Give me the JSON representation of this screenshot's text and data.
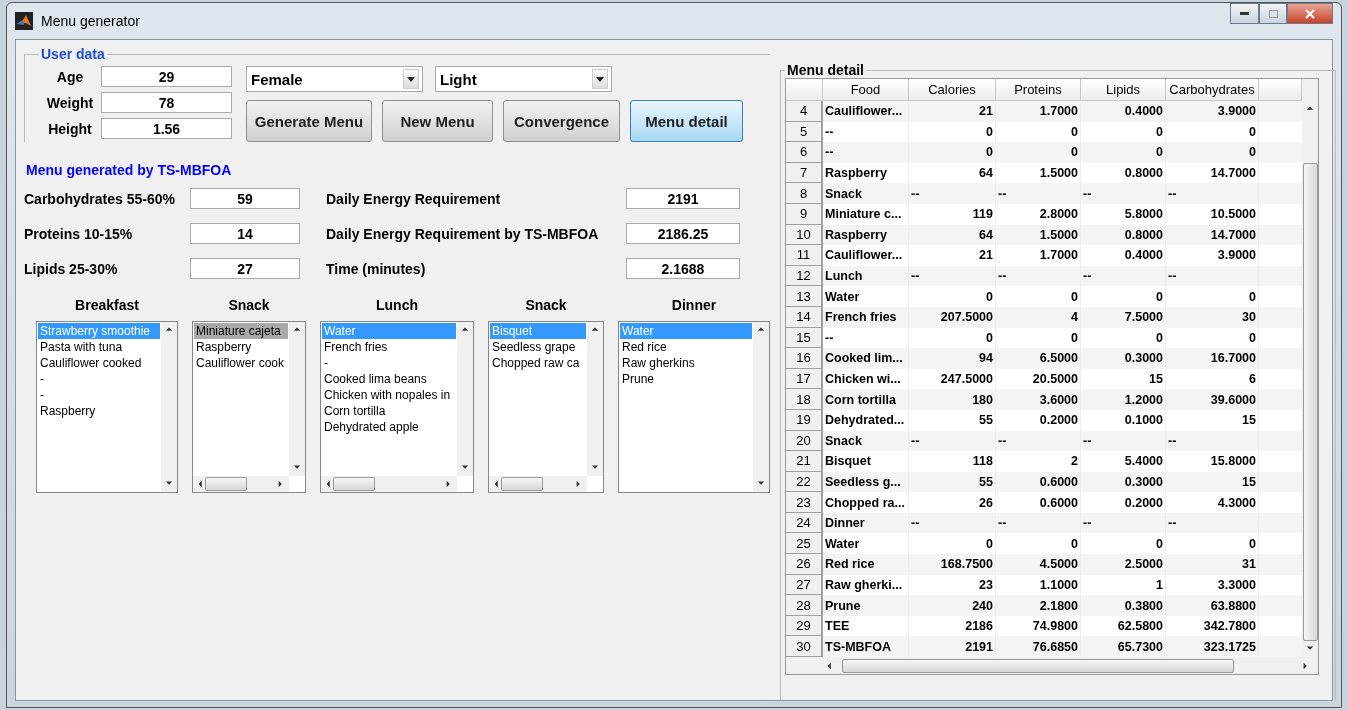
{
  "window": {
    "title": "Menu generator"
  },
  "user_data": {
    "title": "User data",
    "fields": [
      {
        "label": "Age",
        "value": "29"
      },
      {
        "label": "Weight",
        "value": "78"
      },
      {
        "label": "Height",
        "value": "1.56"
      }
    ],
    "dropdowns": [
      {
        "value": "Female"
      },
      {
        "value": "Light"
      }
    ],
    "buttons": [
      {
        "label": "Generate Menu",
        "focused": false
      },
      {
        "label": "New Menu",
        "focused": false
      },
      {
        "label": "Convergence",
        "focused": false
      },
      {
        "label": "Menu detail",
        "focused": true
      }
    ]
  },
  "results": {
    "title": "Menu generated by TS-MBFOA",
    "macros": [
      {
        "label": "Carbohydrates 55-60%",
        "value": "59"
      },
      {
        "label": "Proteins 10-15%",
        "value": "14"
      },
      {
        "label": "Lipids 25-30%",
        "value": "27"
      }
    ],
    "energy": [
      {
        "label": "Daily Energy Requirement",
        "value": "2191"
      },
      {
        "label": "Daily Energy Requirement by TS-MBFOA",
        "value": "2186.25"
      },
      {
        "label": "Time (minutes)",
        "value": "2.1688"
      }
    ]
  },
  "meals": [
    {
      "title": "Breakfast",
      "active": true,
      "horizontal_scrollbar": false,
      "items": [
        {
          "text": "Strawberry smoothie",
          "selected": true
        },
        {
          "text": "Pasta with tuna",
          "selected": false
        },
        {
          "text": "Cauliflower cooked",
          "selected": false
        },
        {
          "text": "-",
          "selected": false
        },
        {
          "text": "-",
          "selected": false
        },
        {
          "text": "Raspberry",
          "selected": false
        }
      ]
    },
    {
      "title": "Snack",
      "active": false,
      "horizontal_scrollbar": true,
      "items": [
        {
          "text": "Miniature cajeta",
          "selected": true
        },
        {
          "text": "Raspberry",
          "selected": false
        },
        {
          "text": "Cauliflower cook",
          "selected": false
        }
      ]
    },
    {
      "title": "Lunch",
      "active": true,
      "horizontal_scrollbar": true,
      "items": [
        {
          "text": "Water",
          "selected": true
        },
        {
          "text": "French fries",
          "selected": false
        },
        {
          "text": "-",
          "selected": false
        },
        {
          "text": "Cooked lima beans",
          "selected": false
        },
        {
          "text": "Chicken with nopales in",
          "selected": false
        },
        {
          "text": "Corn tortilla",
          "selected": false
        },
        {
          "text": "Dehydrated apple",
          "selected": false
        }
      ]
    },
    {
      "title": "Snack",
      "active": true,
      "horizontal_scrollbar": true,
      "items": [
        {
          "text": "Bisquet",
          "selected": true
        },
        {
          "text": "Seedless grape",
          "selected": false
        },
        {
          "text": "Chopped raw ca",
          "selected": false
        }
      ]
    },
    {
      "title": "Dinner",
      "active": true,
      "horizontal_scrollbar": false,
      "items": [
        {
          "text": "Water",
          "selected": true
        },
        {
          "text": "Red rice",
          "selected": false
        },
        {
          "text": "Raw gherkins",
          "selected": false
        },
        {
          "text": "Prune",
          "selected": false
        }
      ]
    }
  ],
  "menu_detail": {
    "title": "Menu detail",
    "columns": [
      "Food",
      "Calories",
      "Proteins",
      "Lipids",
      "Carbohydrates"
    ],
    "rows": [
      {
        "index": "4",
        "kind": "food",
        "cells": [
          "Cauliflower...",
          "21",
          "1.7000",
          "0.4000",
          "3.9000"
        ]
      },
      {
        "index": "5",
        "kind": "food",
        "cells": [
          "--",
          "0",
          "0",
          "0",
          "0"
        ]
      },
      {
        "index": "6",
        "kind": "food",
        "cells": [
          "--",
          "0",
          "0",
          "0",
          "0"
        ]
      },
      {
        "index": "7",
        "kind": "food",
        "cells": [
          "Raspberry",
          "64",
          "1.5000",
          "0.8000",
          "14.7000"
        ]
      },
      {
        "index": "8",
        "kind": "meal",
        "cells": [
          "Snack",
          "--",
          "--",
          "--",
          "--"
        ]
      },
      {
        "index": "9",
        "kind": "food",
        "cells": [
          "Miniature c...",
          "119",
          "2.8000",
          "5.8000",
          "10.5000"
        ]
      },
      {
        "index": "10",
        "kind": "food",
        "cells": [
          "Raspberry",
          "64",
          "1.5000",
          "0.8000",
          "14.7000"
        ]
      },
      {
        "index": "11",
        "kind": "food",
        "cells": [
          "Cauliflower...",
          "21",
          "1.7000",
          "0.4000",
          "3.9000"
        ]
      },
      {
        "index": "12",
        "kind": "meal",
        "cells": [
          "Lunch",
          "--",
          "--",
          "--",
          "--"
        ]
      },
      {
        "index": "13",
        "kind": "food",
        "cells": [
          "Water",
          "0",
          "0",
          "0",
          "0"
        ]
      },
      {
        "index": "14",
        "kind": "food",
        "cells": [
          "French fries",
          "207.5000",
          "4",
          "7.5000",
          "30"
        ]
      },
      {
        "index": "15",
        "kind": "food",
        "cells": [
          "--",
          "0",
          "0",
          "0",
          "0"
        ]
      },
      {
        "index": "16",
        "kind": "food",
        "cells": [
          "Cooked lim...",
          "94",
          "6.5000",
          "0.3000",
          "16.7000"
        ]
      },
      {
        "index": "17",
        "kind": "food",
        "cells": [
          "Chicken wi...",
          "247.5000",
          "20.5000",
          "15",
          "6"
        ]
      },
      {
        "index": "18",
        "kind": "food",
        "cells": [
          "Corn tortilla",
          "180",
          "3.6000",
          "1.2000",
          "39.6000"
        ]
      },
      {
        "index": "19",
        "kind": "food",
        "cells": [
          "Dehydrated...",
          "55",
          "0.2000",
          "0.1000",
          "15"
        ]
      },
      {
        "index": "20",
        "kind": "meal",
        "cells": [
          "Snack",
          "--",
          "--",
          "--",
          "--"
        ]
      },
      {
        "index": "21",
        "kind": "food",
        "cells": [
          "Bisquet",
          "118",
          "2",
          "5.4000",
          "15.8000"
        ]
      },
      {
        "index": "22",
        "kind": "food",
        "cells": [
          "Seedless g...",
          "55",
          "0.6000",
          "0.3000",
          "15"
        ]
      },
      {
        "index": "23",
        "kind": "food",
        "cells": [
          "Chopped ra...",
          "26",
          "0.6000",
          "0.2000",
          "4.3000"
        ]
      },
      {
        "index": "24",
        "kind": "meal",
        "cells": [
          "Dinner",
          "--",
          "--",
          "--",
          "--"
        ]
      },
      {
        "index": "25",
        "kind": "food",
        "cells": [
          "Water",
          "0",
          "0",
          "0",
          "0"
        ]
      },
      {
        "index": "26",
        "kind": "food",
        "cells": [
          "Red rice",
          "168.7500",
          "4.5000",
          "2.5000",
          "31"
        ]
      },
      {
        "index": "27",
        "kind": "food",
        "cells": [
          "Raw gherki...",
          "23",
          "1.1000",
          "1",
          "3.3000"
        ]
      },
      {
        "index": "28",
        "kind": "food",
        "cells": [
          "Prune",
          "240",
          "2.1800",
          "0.3800",
          "63.8800"
        ]
      },
      {
        "index": "29",
        "kind": "food",
        "cells": [
          "TEE",
          "2186",
          "74.9800",
          "62.5800",
          "342.7800"
        ]
      },
      {
        "index": "30",
        "kind": "food",
        "cells": [
          "TS-MBFOA",
          "2191",
          "76.6850",
          "65.7300",
          "323.1725"
        ]
      }
    ]
  }
}
